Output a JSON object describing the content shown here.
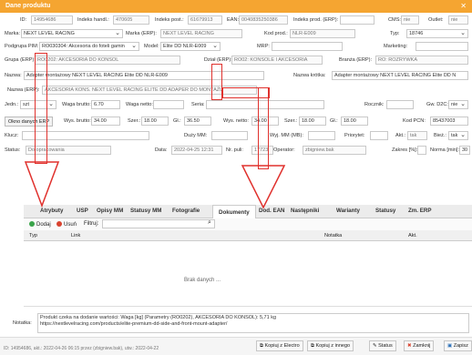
{
  "window": {
    "title": "Dane produktu",
    "close": "✕"
  },
  "row1": {
    "id_label": "ID:",
    "id": "14954686",
    "handl_label": "Indeks handl.:",
    "handl": "470605",
    "post_label": "Indeks post.:",
    "post": "61679913",
    "ean_label": "EAN:",
    "ean": "0040835250386",
    "erp_label": "Indeks prod. (ERP):",
    "erp": "",
    "cms_label": "CMS:",
    "cms": "nie",
    "outlet_label": "Outlet:",
    "outlet": "nie"
  },
  "row2": {
    "marka_label": "Marka:",
    "marka": "NEXT LEVEL RACING",
    "marka_erp_label": "Marka (ERP):",
    "marka_erp": "NEXT LEVEL RACING",
    "kod_label": "Kod prod.:",
    "kod": "NLR-E009",
    "typ_label": "Typ:",
    "typ": "18746"
  },
  "row3": {
    "pim_label": "Podgrupa PIM:",
    "pim": "RO030304: Akcesoria do foteli gamin",
    "model_label": "Model:",
    "model": "Elite DD NLR-E009",
    "mrp_label": "MRP:",
    "mrp": "",
    "mkt_label": "Marketing:",
    "mkt": ""
  },
  "row4": {
    "grupa_label": "Grupa (ERP):",
    "grupa": "RO0202: AKCESORIA DO KONSOL",
    "dzial_label": "Dział (ERP):",
    "dzial": "RO02: KONSOLE I AKCESORIA",
    "branza_label": "Branża (ERP):",
    "branza": "RO: ROZRYWKA"
  },
  "row5": {
    "nazwa_label": "Nazwa:",
    "nazwa": "Adapter montażowy NEXT LEVEL RACING Elite DD NLR-E009",
    "krotka_label": "Nazwa krótka:",
    "krotka": "Adapter montażowy NEXT LEVEL RACING Elite DD N"
  },
  "row6": {
    "nazwa_erp_label": "Nazwa (ERP):",
    "nazwa_erp": "AKCESORIA KONS. NEXT LEVEL RACING ELITE DD ADAPER DO MONTAŻU"
  },
  "row7": {
    "jedn_label": "Jedn.:",
    "jedn": "szt",
    "brutto_label": "Waga brutto:",
    "brutto": "6.70",
    "netto_label": "Waga netto:",
    "netto": "",
    "seria_label": "Seria:",
    "seria": "",
    "rocznik_label": "Rocznik:",
    "rocznik": "",
    "gw_label": "Gw. D2C:",
    "gw": "nie"
  },
  "row8": {
    "okno_btn": "Okno danych ERP",
    "wys_b_label": "Wys. brutto:",
    "wys_b": "34.00",
    "szer_b_label": "Szer.:",
    "szer_b": "18.00",
    "gl_b_label": "Gł.:",
    "gl_b": "36.50",
    "wys_n_label": "Wys. netto:",
    "wys_n": "34.00",
    "szer_n_label": "Szer.:",
    "szer_n": "18.00",
    "gl_n_label": "Gł.:",
    "gl_n": "18.00",
    "pcn_label": "Kod PCN:",
    "pcn": "85437003"
  },
  "row9": {
    "klucz_label": "Klucz:",
    "klucz": "",
    "duzy_label": "Duży MM:",
    "duzy": "",
    "wyj_label": "Wyj. MM (MB):",
    "wyj": "",
    "prio_label": "Priorytet:",
    "prio": "",
    "akt_label": "Akt.:",
    "akt": "tak",
    "biez_label": "Bież.:",
    "biez": "tak"
  },
  "row10": {
    "status_label": "Status:",
    "status": "Do opracowania",
    "data_label": "Data:",
    "data": "2022-04-25 12:31",
    "nr_label": "Nr. puli:",
    "nr": "17723",
    "op_label": "Operator:",
    "op": "zbigniew.bak",
    "zakres_label": "Zakres [%]:",
    "zakres": "",
    "norma_label": "Norma [min]:",
    "norma": "30"
  },
  "tabs": [
    "Atrybuty",
    "USP",
    "Opisy MM",
    "Statusy MM",
    "Fotografie",
    "Dokumenty",
    "Dod. EAN",
    "Następniki",
    "Warianty",
    "Statusy",
    "Zm. ERP"
  ],
  "toolbar": {
    "add": "Dodaj",
    "remove": "Usuń",
    "filter_label": "Filtruj:",
    "filter": "",
    "search_icon": "search-icon"
  },
  "grid": {
    "columns": [
      "Typ",
      "Link",
      "Notatka",
      "Akt."
    ],
    "empty": "Brak danych ..."
  },
  "note": {
    "label": "Notatka:",
    "text1": "Produkt czeka na dodanie wartości: Waga [kg] (Parametry (RO0202), AKCESORIA DO KONSOL): 5,71 kg",
    "text2": "https://nextlevelracing.com/products/elite-premium-dd-side-and-front-mount-adapter/"
  },
  "footer": {
    "meta": "ID: 14954686, akt.: 2022-04-26 06:15 przez (zbigniew.bak), utw.: 2022-04-22",
    "copy_electro": "Kopiuj z Electro",
    "copy_other": "Kopiuj z innego",
    "status": "Status",
    "close": "Zamknij",
    "save": "Zapisz"
  },
  "colors": {
    "accent": "#f5a531",
    "arrow": "#e0312d"
  }
}
